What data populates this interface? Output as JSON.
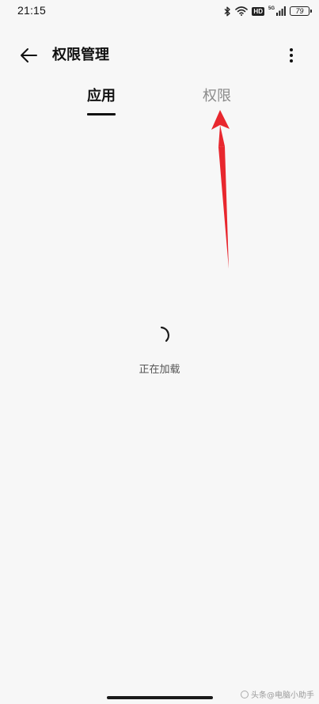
{
  "status_bar": {
    "time": "21:15",
    "signal_label": "5G",
    "hd_label": "HD",
    "battery_level": "79",
    "icons": [
      "bluetooth-icon",
      "wifi-icon",
      "hd-icon",
      "cellular-signal-icon",
      "battery-icon"
    ]
  },
  "header": {
    "title": "权限管理",
    "back_icon": "arrow-left-icon",
    "more_icon": "more-vertical-icon"
  },
  "tabs": [
    {
      "label": "应用",
      "selected": true
    },
    {
      "label": "权限",
      "selected": false
    }
  ],
  "loading": {
    "text": "正在加载"
  },
  "annotation": {
    "color": "#e8272e"
  },
  "watermark": {
    "text": "头条@电脑小助手"
  }
}
